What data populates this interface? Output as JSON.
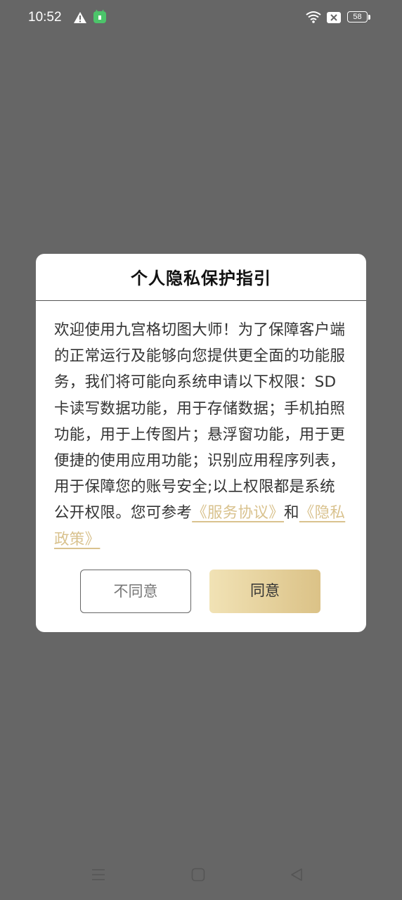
{
  "status_bar": {
    "time": "10:52",
    "battery_level": "58",
    "icons": [
      "warning-icon",
      "app-notification-icon",
      "wifi-icon",
      "x-box-icon",
      "battery-icon"
    ]
  },
  "dialog": {
    "title": "个人隐私保护指引",
    "body_text": "欢迎使用九宫格切图大师！为了保障客户端的正常运行及能够向您提供更全面的功能服务，我们将可能向系统申请以下权限：SD卡读写数据功能，用于存储数据；手机拍照功能，用于上传图片；悬浮窗功能，用于更便捷的使用应用功能；识别应用程序列表，用于保障您的账号安全;以上权限都是系统公开权限。您可参考",
    "link_service": "《服务协议》",
    "conjunction": "和",
    "link_privacy": "《隐私政策》",
    "disagree_label": "不同意",
    "agree_label": "同意"
  },
  "nav_bar": {
    "icons": [
      "menu-icon",
      "home-icon",
      "back-icon"
    ]
  },
  "colors": {
    "overlay": "#666666",
    "link": "#d9c28e",
    "agree_gradient_start": "#f1e2b5",
    "agree_gradient_end": "#dbc287"
  }
}
